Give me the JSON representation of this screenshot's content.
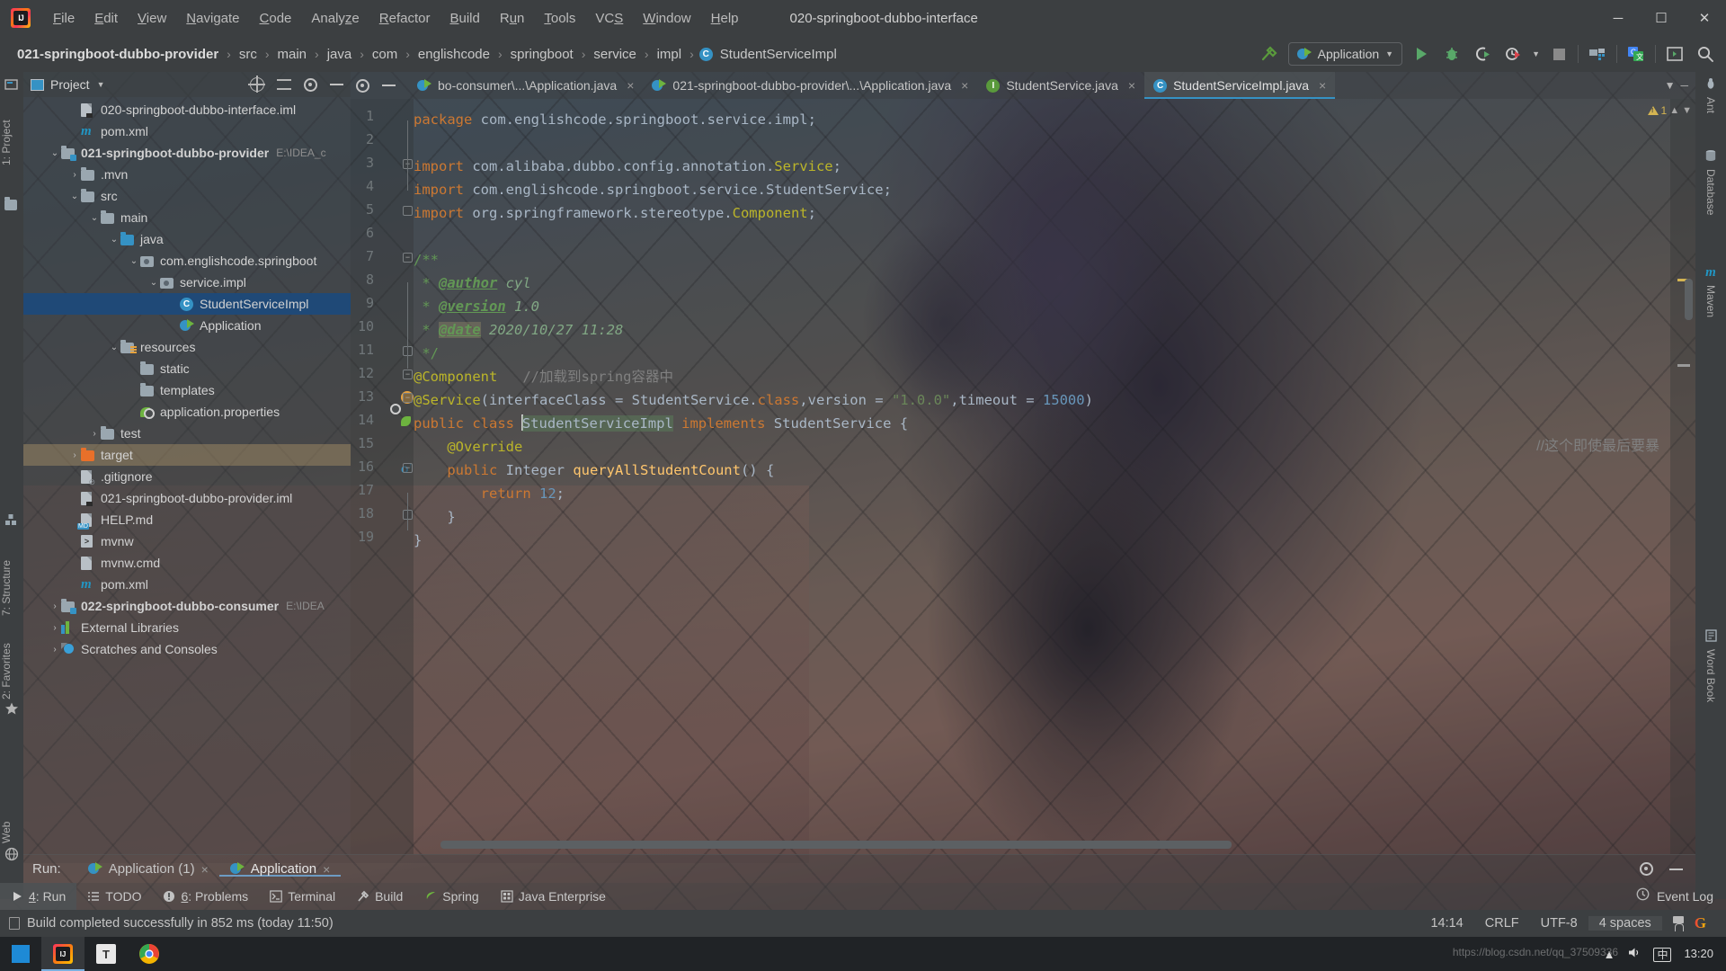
{
  "window": {
    "title": "020-springboot-dubbo-interface",
    "logo_icon": "intellij-logo-icon",
    "minimize_icon": "minimize-icon",
    "maximize_icon": "maximize-icon",
    "close_icon": "close-icon"
  },
  "menu": [
    {
      "label": "File",
      "mnemonic": "F"
    },
    {
      "label": "Edit",
      "mnemonic": "E"
    },
    {
      "label": "View",
      "mnemonic": "V"
    },
    {
      "label": "Navigate",
      "mnemonic": "N"
    },
    {
      "label": "Code",
      "mnemonic": "C"
    },
    {
      "label": "Analyze",
      "mnemonic": "z"
    },
    {
      "label": "Refactor",
      "mnemonic": "R"
    },
    {
      "label": "Build",
      "mnemonic": "B"
    },
    {
      "label": "Run",
      "mnemonic": "u"
    },
    {
      "label": "Tools",
      "mnemonic": "T"
    },
    {
      "label": "VCS",
      "mnemonic": "S"
    },
    {
      "label": "Window",
      "mnemonic": "W"
    },
    {
      "label": "Help",
      "mnemonic": "H"
    }
  ],
  "breadcrumb": [
    {
      "label": "021-springboot-dubbo-provider",
      "bold": true,
      "icon": null
    },
    {
      "label": "src",
      "bold": false,
      "icon": null
    },
    {
      "label": "main",
      "bold": false,
      "icon": null
    },
    {
      "label": "java",
      "bold": false,
      "icon": null
    },
    {
      "label": "com",
      "bold": false,
      "icon": null
    },
    {
      "label": "englishcode",
      "bold": false,
      "icon": null
    },
    {
      "label": "springboot",
      "bold": false,
      "icon": null
    },
    {
      "label": "service",
      "bold": false,
      "icon": null
    },
    {
      "label": "impl",
      "bold": false,
      "icon": null
    },
    {
      "label": "StudentServiceImpl",
      "bold": false,
      "icon": "C"
    }
  ],
  "toolbar": {
    "build_icon": "hammer-icon",
    "run_config": "Application",
    "run_config_icon": "spring-boot-icon",
    "dropdown_icon": "chevron-down-icon",
    "run_icon": "run-play-icon",
    "debug_icon": "debug-bug-icon",
    "run_coverage_icon": "run-with-coverage-icon",
    "profiler_icon": "profiler-clock-icon",
    "stop_icon": "stop-square-icon",
    "project_structure_icon": "project-structure-icon",
    "translate_icon": "google-translate-icon",
    "terminal_icon": "terminal-window-icon",
    "search_icon": "search-everywhere-icon"
  },
  "left_stripe": [
    {
      "label": "1: Project",
      "icon": "project-icon"
    },
    {
      "label": "7: Structure",
      "icon": "structure-icon"
    },
    {
      "label": "2: Favorites",
      "icon": "favorites-star-icon"
    },
    {
      "label": "Web",
      "icon": "web-globe-icon"
    }
  ],
  "right_stripe": [
    {
      "label": "Ant",
      "icon": "ant-icon"
    },
    {
      "label": "Database",
      "icon": "database-icon"
    },
    {
      "label": "Maven",
      "icon": "maven-m-icon"
    },
    {
      "label": "Word Book",
      "icon": "word-book-icon"
    }
  ],
  "project_panel": {
    "title": "Project",
    "title_dropdown_icon": "chevron-down-icon",
    "locate_icon": "locate-target-icon",
    "collapse_icon": "collapse-all-icon",
    "settings_icon": "gear-icon",
    "hide_icon": "hide-minus-icon",
    "tree": [
      {
        "label": "020-springboot-dubbo-interface.iml",
        "indent": 2,
        "icon": "iml-file-icon",
        "arrow": "",
        "state": "normal",
        "path": ""
      },
      {
        "label": "pom.xml",
        "indent": 2,
        "icon": "maven-icon",
        "arrow": "",
        "state": "normal",
        "path": ""
      },
      {
        "label": "021-springboot-dubbo-provider",
        "indent": 1,
        "icon": "module-folder-icon",
        "arrow": "v",
        "state": "bold",
        "path": "E:\\IDEA_c"
      },
      {
        "label": ".mvn",
        "indent": 2,
        "icon": "folder-icon",
        "arrow": ">",
        "state": "normal",
        "path": ""
      },
      {
        "label": "src",
        "indent": 2,
        "icon": "folder-icon",
        "arrow": "v",
        "state": "normal",
        "path": ""
      },
      {
        "label": "main",
        "indent": 3,
        "icon": "folder-icon",
        "arrow": "v",
        "state": "normal",
        "path": ""
      },
      {
        "label": "java",
        "indent": 4,
        "icon": "source-folder-icon",
        "arrow": "v",
        "state": "normal",
        "path": ""
      },
      {
        "label": "com.englishcode.springboot",
        "indent": 5,
        "icon": "package-icon",
        "arrow": "v",
        "state": "normal",
        "path": ""
      },
      {
        "label": "service.impl",
        "indent": 6,
        "icon": "package-icon",
        "arrow": "v",
        "state": "normal",
        "path": ""
      },
      {
        "label": "StudentServiceImpl",
        "indent": 7,
        "icon": "java-class-icon",
        "arrow": "",
        "state": "selected",
        "path": ""
      },
      {
        "label": "Application",
        "indent": 7,
        "icon": "spring-run-icon",
        "arrow": "",
        "state": "normal",
        "path": ""
      },
      {
        "label": "resources",
        "indent": 4,
        "icon": "resources-folder-icon",
        "arrow": "v",
        "state": "normal",
        "path": ""
      },
      {
        "label": "static",
        "indent": 5,
        "icon": "folder-icon",
        "arrow": "",
        "state": "normal",
        "path": ""
      },
      {
        "label": "templates",
        "indent": 5,
        "icon": "folder-icon",
        "arrow": "",
        "state": "normal",
        "path": ""
      },
      {
        "label": "application.properties",
        "indent": 5,
        "icon": "spring-config-icon",
        "arrow": "",
        "state": "normal",
        "path": ""
      },
      {
        "label": "test",
        "indent": 3,
        "icon": "folder-icon",
        "arrow": ">",
        "state": "normal",
        "path": ""
      },
      {
        "label": "target",
        "indent": 2,
        "icon": "excluded-folder-icon",
        "arrow": ">",
        "state": "highlighted",
        "path": ""
      },
      {
        "label": ".gitignore",
        "indent": 2,
        "icon": "gitignore-file-icon",
        "arrow": "",
        "state": "normal",
        "path": ""
      },
      {
        "label": "021-springboot-dubbo-provider.iml",
        "indent": 2,
        "icon": "iml-file-icon",
        "arrow": "",
        "state": "normal",
        "path": ""
      },
      {
        "label": "HELP.md",
        "indent": 2,
        "icon": "markdown-file-icon",
        "arrow": "",
        "state": "normal",
        "path": ""
      },
      {
        "label": "mvnw",
        "indent": 2,
        "icon": "shell-script-icon",
        "arrow": "",
        "state": "normal",
        "path": ""
      },
      {
        "label": "mvnw.cmd",
        "indent": 2,
        "icon": "cmd-script-icon",
        "arrow": "",
        "state": "normal",
        "path": ""
      },
      {
        "label": "pom.xml",
        "indent": 2,
        "icon": "maven-icon",
        "arrow": "",
        "state": "normal",
        "path": ""
      },
      {
        "label": "022-springboot-dubbo-consumer",
        "indent": 1,
        "icon": "module-folder-icon",
        "arrow": ">",
        "state": "bold",
        "path": "E:\\IDEA"
      },
      {
        "label": "External Libraries",
        "indent": 1,
        "icon": "libraries-icon",
        "arrow": ">",
        "state": "normal",
        "path": ""
      },
      {
        "label": "Scratches and Consoles",
        "indent": 1,
        "icon": "scratches-icon",
        "arrow": ">",
        "state": "normal",
        "path": ""
      }
    ]
  },
  "editor_tabs": [
    {
      "label": "bo-consumer\\...\\Application.java",
      "icon": "spring-run-icon",
      "active": false,
      "closable": true
    },
    {
      "label": "021-springboot-dubbo-provider\\...\\Application.java",
      "icon": "spring-run-icon",
      "active": false,
      "closable": true
    },
    {
      "label": "StudentService.java",
      "icon": "java-interface-icon",
      "active": false,
      "closable": true
    },
    {
      "label": "StudentServiceImpl.java",
      "icon": "java-class-icon",
      "active": true,
      "closable": true
    }
  ],
  "editor": {
    "warning_count": "1",
    "warning_icon": "warning-triangle-icon",
    "up_icon": "chevron-up-icon",
    "down_icon": "chevron-down-icon",
    "lines": [
      {
        "n": "1",
        "fold": "",
        "gmark": "",
        "segments": [
          {
            "t": "package ",
            "c": "kw"
          },
          {
            "t": "com.englishcode.springboot.service.impl;",
            "c": "pln"
          }
        ]
      },
      {
        "n": "2",
        "fold": "",
        "gmark": "",
        "segments": []
      },
      {
        "n": "3",
        "fold": "-",
        "gmark": "",
        "segments": [
          {
            "t": "import ",
            "c": "kw"
          },
          {
            "t": "com.alibaba.dubbo.config.annotation.",
            "c": "pln"
          },
          {
            "t": "Service",
            "c": "ann"
          },
          {
            "t": ";",
            "c": "pln"
          }
        ]
      },
      {
        "n": "4",
        "fold": "",
        "gmark": "",
        "segments": [
          {
            "t": "import ",
            "c": "kw"
          },
          {
            "t": "com.englishcode.springboot.service.StudentService;",
            "c": "pln"
          }
        ]
      },
      {
        "n": "5",
        "fold": "=",
        "gmark": "",
        "segments": [
          {
            "t": "import ",
            "c": "kw"
          },
          {
            "t": "org.springframework.stereotype.",
            "c": "pln"
          },
          {
            "t": "Component",
            "c": "ann"
          },
          {
            "t": ";",
            "c": "pln"
          }
        ]
      },
      {
        "n": "6",
        "fold": "",
        "gmark": "",
        "segments": []
      },
      {
        "n": "7",
        "fold": "-",
        "gmark": "",
        "segments": [
          {
            "t": "/**",
            "c": "doc"
          }
        ]
      },
      {
        "n": "8",
        "fold": "",
        "gmark": "",
        "segments": [
          {
            "t": " * ",
            "c": "doc"
          },
          {
            "t": "@author",
            "c": "doct"
          },
          {
            "t": " cyl",
            "c": "docv"
          }
        ]
      },
      {
        "n": "9",
        "fold": "",
        "gmark": "",
        "segments": [
          {
            "t": " * ",
            "c": "doc"
          },
          {
            "t": "@version",
            "c": "doct"
          },
          {
            "t": " 1.0",
            "c": "docv"
          }
        ]
      },
      {
        "n": "10",
        "fold": "",
        "gmark": "",
        "segments": [
          {
            "t": " * ",
            "c": "doc"
          },
          {
            "t": "@date",
            "c": "doct hl-date"
          },
          {
            "t": " 2020/10/27 11:28",
            "c": "docv"
          }
        ]
      },
      {
        "n": "11",
        "fold": "=",
        "gmark": "",
        "segments": [
          {
            "t": " */",
            "c": "doc"
          }
        ]
      },
      {
        "n": "12",
        "fold": "-",
        "gmark": "",
        "segments": [
          {
            "t": "@Component",
            "c": "ann"
          },
          {
            "t": "   ",
            "c": "pln"
          },
          {
            "t": "//加载到spring容器中",
            "c": "cmt"
          }
        ]
      },
      {
        "n": "13",
        "fold": "-",
        "gmark": "bulb",
        "segments": [
          {
            "t": "@Service",
            "c": "ann"
          },
          {
            "t": "(interfaceClass = StudentService.",
            "c": "pln"
          },
          {
            "t": "class",
            "c": "kw"
          },
          {
            "t": ",version = ",
            "c": "pln"
          },
          {
            "t": "\"1.0.0\"",
            "c": "str"
          },
          {
            "t": ",timeout = ",
            "c": "pln"
          },
          {
            "t": "15000",
            "c": "num"
          },
          {
            "t": ")",
            "c": "pln"
          }
        ]
      },
      {
        "n": "14",
        "fold": "",
        "gmark": "spring",
        "segments": [
          {
            "t": "public class ",
            "c": "kw"
          },
          {
            "t": "|",
            "c": "caret"
          },
          {
            "t": "StudentServiceImpl",
            "c": "pln sel-tok"
          },
          {
            "t": " implements ",
            "c": "kw"
          },
          {
            "t": "StudentService {",
            "c": "pln"
          }
        ]
      },
      {
        "n": "15",
        "fold": "",
        "gmark": "",
        "segments": [
          {
            "t": "    ",
            "c": "pln"
          },
          {
            "t": "@Override",
            "c": "ann"
          }
        ]
      },
      {
        "n": "16",
        "fold": "-",
        "gmark": "override",
        "segments": [
          {
            "t": "    public ",
            "c": "kw"
          },
          {
            "t": "Integer ",
            "c": "pln"
          },
          {
            "t": "queryAllStudentCount",
            "c": "mth"
          },
          {
            "t": "() {",
            "c": "pln"
          }
        ]
      },
      {
        "n": "17",
        "fold": "",
        "gmark": "",
        "segments": [
          {
            "t": "        ",
            "c": "pln"
          },
          {
            "t": "return ",
            "c": "kw"
          },
          {
            "t": "12",
            "c": "num"
          },
          {
            "t": ";",
            "c": "pln"
          }
        ]
      },
      {
        "n": "18",
        "fold": "=",
        "gmark": "",
        "segments": [
          {
            "t": "    }",
            "c": "pln"
          }
        ]
      },
      {
        "n": "19",
        "fold": "",
        "gmark": "",
        "segments": [
          {
            "t": "}",
            "c": "pln"
          }
        ]
      }
    ],
    "trailing_comment": "//这个即使最后要暴"
  },
  "run_window": {
    "label": "Run:",
    "tabs": [
      {
        "label": "Application (1)",
        "icon": "spring-boot-icon",
        "active": false
      },
      {
        "label": "Application",
        "icon": "spring-boot-icon",
        "active": true
      }
    ],
    "settings_icon": "gear-icon",
    "hide_icon": "hide-minus-icon"
  },
  "bottom_bar": [
    {
      "label": "4: Run",
      "mnemonic": "4",
      "icon": "run-play-icon",
      "active": true
    },
    {
      "label": "TODO",
      "mnemonic": "",
      "icon": "todo-list-icon",
      "active": false
    },
    {
      "label": "6: Problems",
      "mnemonic": "6",
      "icon": "problems-icon",
      "active": false
    },
    {
      "label": "Terminal",
      "mnemonic": "",
      "icon": "terminal-icon",
      "active": false
    },
    {
      "label": "Build",
      "mnemonic": "",
      "icon": "hammer-icon",
      "active": false
    },
    {
      "label": "Spring",
      "mnemonic": "",
      "icon": "spring-leaf-icon",
      "active": false
    },
    {
      "label": "Java Enterprise",
      "mnemonic": "",
      "icon": "java-enterprise-icon",
      "active": false
    }
  ],
  "bottom_bar_right": {
    "label": "Event Log",
    "icon": "event-log-icon"
  },
  "status_bar": {
    "message": "Build completed successfully in 852 ms (today 11:50)",
    "message_icon": "build-status-icon",
    "caret_position": "14:14",
    "line_separator": "CRLF",
    "encoding": "UTF-8",
    "indent": "4 spaces",
    "lock_icon": "unlocked-icon",
    "google_icon": "google-icon"
  },
  "taskbar": {
    "start_icon": "windows-start-icon",
    "apps": [
      {
        "name": "idea-app-icon",
        "active": true
      },
      {
        "name": "text-editor-icon",
        "active": false
      },
      {
        "name": "chrome-icon",
        "active": false
      }
    ],
    "tray": {
      "expand_icon": "chevron-up-icon",
      "volume_icon": "volume-icon",
      "ime_icon": "ime-cn-icon",
      "ime_label": "中",
      "clock_time": "13:20"
    }
  },
  "watermark": "https://blog.csdn.net/qq_37509336"
}
